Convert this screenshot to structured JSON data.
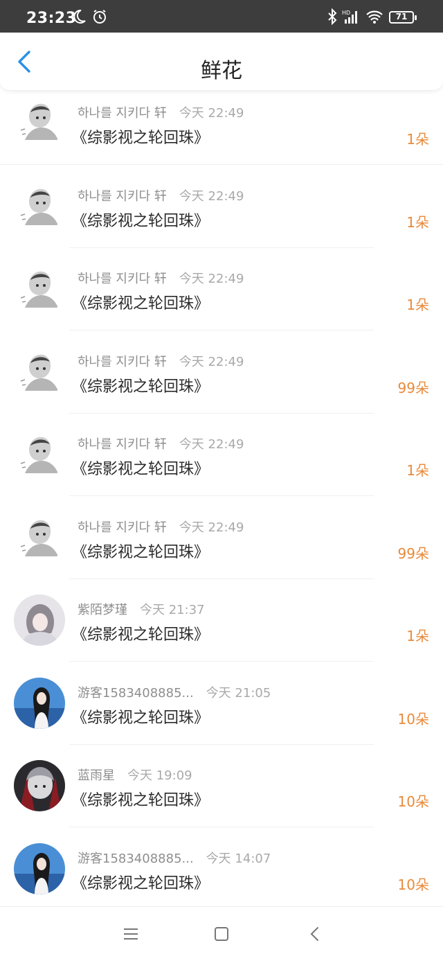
{
  "status_bar": {
    "time": "23:23",
    "left_icons": [
      "moon-icon",
      "alarm-icon"
    ],
    "right_icons": [
      "bluetooth-icon",
      "hd-signal-icon",
      "wifi-icon",
      "battery-icon"
    ],
    "signal_label": "HD",
    "battery": "71"
  },
  "header": {
    "title": "鲜花",
    "back_icon": "chevron-left-icon",
    "accent_color": "#2a90e8"
  },
  "list": {
    "count_color": "#e88a3a",
    "items": [
      {
        "name": "하나를 지키다 轩",
        "time": "今天 22:49",
        "book": "《综影视之轮回珠》",
        "count": "1朵",
        "avatar": "ink-sketch-avatar"
      },
      {
        "name": "하나를 지키다 轩",
        "time": "今天 22:49",
        "book": "《综影视之轮回珠》",
        "count": "1朵",
        "avatar": "ink-sketch-avatar"
      },
      {
        "name": "하나를 지키다 轩",
        "time": "今天 22:49",
        "book": "《综影视之轮回珠》",
        "count": "1朵",
        "avatar": "ink-sketch-avatar"
      },
      {
        "name": "하나를 지키다 轩",
        "time": "今天 22:49",
        "book": "《综影视之轮回珠》",
        "count": "99朵",
        "avatar": "ink-sketch-avatar"
      },
      {
        "name": "하나를 지키다 轩",
        "time": "今天 22:49",
        "book": "《综影视之轮回珠》",
        "count": "1朵",
        "avatar": "ink-sketch-avatar"
      },
      {
        "name": "하나를 지키다 轩",
        "time": "今天 22:49",
        "book": "《综影视之轮回珠》",
        "count": "99朵",
        "avatar": "ink-sketch-avatar"
      },
      {
        "name": "紫陌梦瑾",
        "time": "今天 21:37",
        "book": "《综影视之轮回珠》",
        "count": "1朵",
        "avatar": "ancient-style-avatar"
      },
      {
        "name": "游客1583408885...",
        "time": "今天 21:05",
        "book": "《综影视之轮回珠》",
        "count": "10朵",
        "avatar": "seaside-avatar"
      },
      {
        "name": "蓝雨星",
        "time": "今天 19:09",
        "book": "《综影视之轮回珠》",
        "count": "10朵",
        "avatar": "dark-anime-avatar"
      },
      {
        "name": "游客1583408885...",
        "time": "今天 14:07",
        "book": "《综影视之轮回珠》",
        "count": "10朵",
        "avatar": "seaside-avatar"
      }
    ]
  },
  "nav_bar": {
    "icons": [
      "menu-icon",
      "home-square-icon",
      "back-triangle-icon"
    ]
  }
}
